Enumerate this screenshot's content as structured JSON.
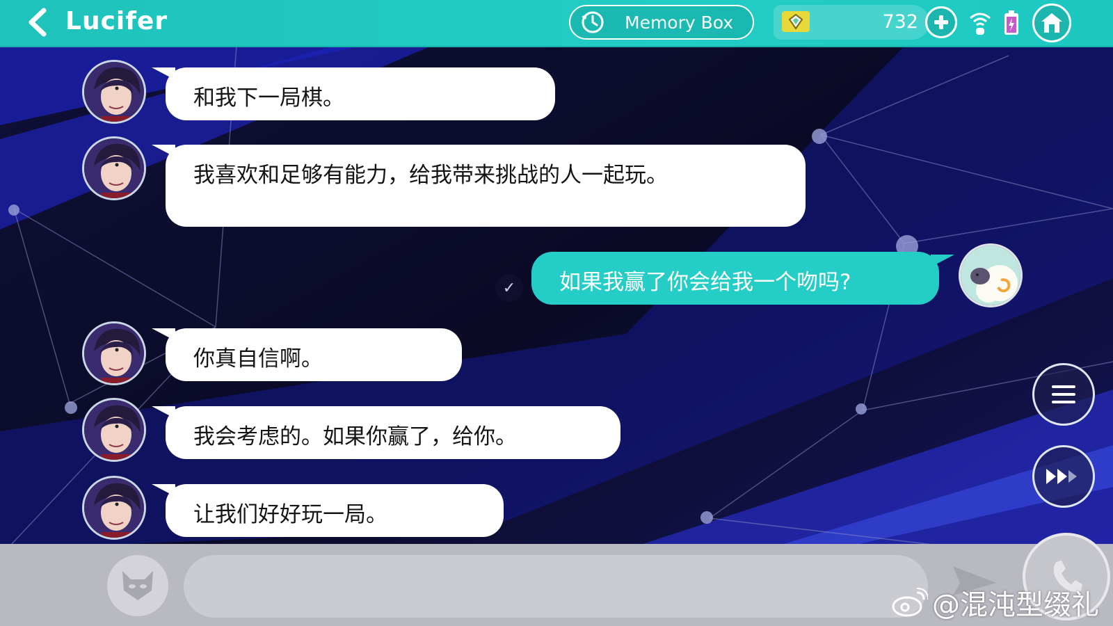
{
  "header": {
    "title": "Lucifer",
    "memory_box_label": "Memory Box",
    "currency_amount": "732"
  },
  "chat": {
    "messages": [
      {
        "sender": "Lucifer",
        "side": "left",
        "text": "和我下一局棋。"
      },
      {
        "sender": "Lucifer",
        "side": "left",
        "text": "我喜欢和足够有能力，给我带来挑战的人一起玩。"
      },
      {
        "sender": "me",
        "side": "right",
        "text": "如果我赢了你会给我一个吻吗?",
        "read_mark": "✓"
      },
      {
        "sender": "Lucifer",
        "side": "left",
        "text": "你真自信啊。"
      },
      {
        "sender": "Lucifer",
        "side": "left",
        "text": "我会考虑的。如果你赢了，给你。"
      },
      {
        "sender": "Lucifer",
        "side": "left",
        "text": "让我们好好玩一局。"
      }
    ]
  },
  "input": {
    "value": "",
    "placeholder": ""
  },
  "watermark": {
    "text": "@混沌型缀礼"
  },
  "icons": {
    "back": "chevron-left-icon",
    "memory": "history-clock-icon",
    "currency": "gem-icon",
    "add": "plus-icon",
    "wifi": "wifi-icon",
    "battery": "battery-charging-icon",
    "home": "home-icon",
    "menu": "menu-icon",
    "fast_forward": "fast-forward-icon",
    "emoji": "demon-face-icon",
    "send": "send-icon",
    "call": "phone-icon"
  },
  "colors": {
    "header": "#22cdc6",
    "player_bubble": "#24cdc6",
    "npc_bubble": "#ffffff",
    "bottom_bar": "#b9b9c2"
  }
}
